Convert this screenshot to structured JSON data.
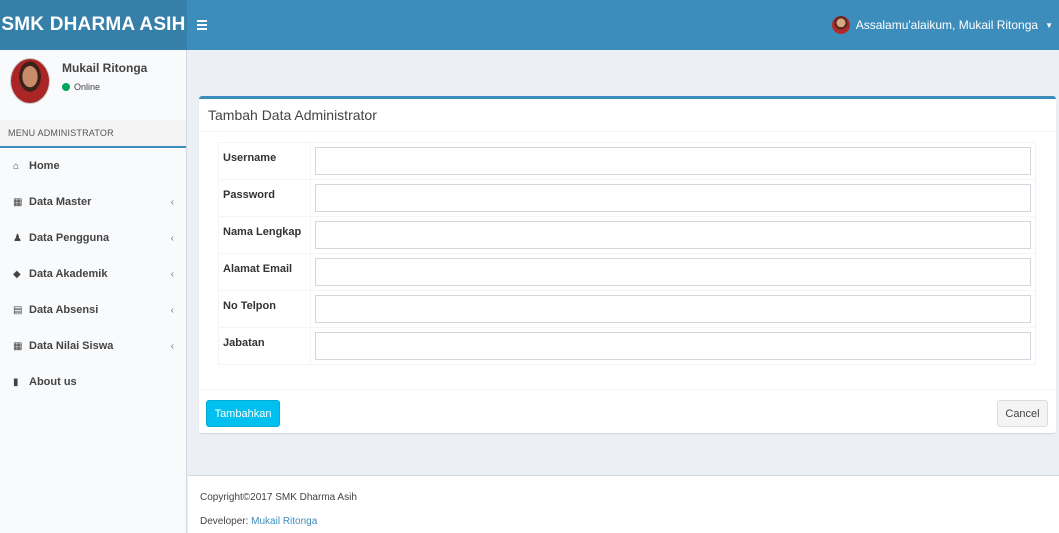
{
  "header": {
    "logo_text": "SMK DHARMA ASIH",
    "toggle_icon": "hamburger-icon",
    "user_greeting": "Assalamu'alaikum, Mukail Ritonga"
  },
  "sidebar": {
    "user_name": "Mukail Ritonga",
    "status": "Online",
    "menu_header": "MENU ADMINISTRATOR",
    "items": [
      {
        "label": "Home",
        "icon": "home-icon",
        "glyph": "⌂",
        "has_arrow": false
      },
      {
        "label": "Data Master",
        "icon": "table-icon",
        "glyph": "▦",
        "has_arrow": true
      },
      {
        "label": "Data Pengguna",
        "icon": "user-icon",
        "glyph": "♟",
        "has_arrow": true
      },
      {
        "label": "Data Akademik",
        "icon": "tag-icon",
        "glyph": "◆",
        "has_arrow": true
      },
      {
        "label": "Data Absensi",
        "icon": "calendar-icon",
        "glyph": "▤",
        "has_arrow": true
      },
      {
        "label": "Data Nilai Siswa",
        "icon": "grid-icon",
        "glyph": "▦",
        "has_arrow": true
      },
      {
        "label": "About us",
        "icon": "book-icon",
        "glyph": "▮",
        "has_arrow": false
      }
    ],
    "arrow_glyph": "‹"
  },
  "form": {
    "title": "Tambah Data Administrator",
    "fields": [
      {
        "label": "Username",
        "value": ""
      },
      {
        "label": "Password",
        "value": ""
      },
      {
        "label": "Nama Lengkap",
        "value": ""
      },
      {
        "label": "Alamat Email",
        "value": ""
      },
      {
        "label": "No Telpon",
        "value": ""
      },
      {
        "label": "Jabatan",
        "value": ""
      }
    ],
    "submit_label": "Tambahkan",
    "cancel_label": "Cancel"
  },
  "footer": {
    "copyright": "Copyright©2017 SMK Dharma Asih",
    "developer_prefix": "Developer: ",
    "developer_name": "Mukail Ritonga"
  },
  "colors": {
    "primary": "#3c8dbc",
    "logo_bg": "#367fa9",
    "info_button": "#00c0ef",
    "online": "#00a65a"
  }
}
